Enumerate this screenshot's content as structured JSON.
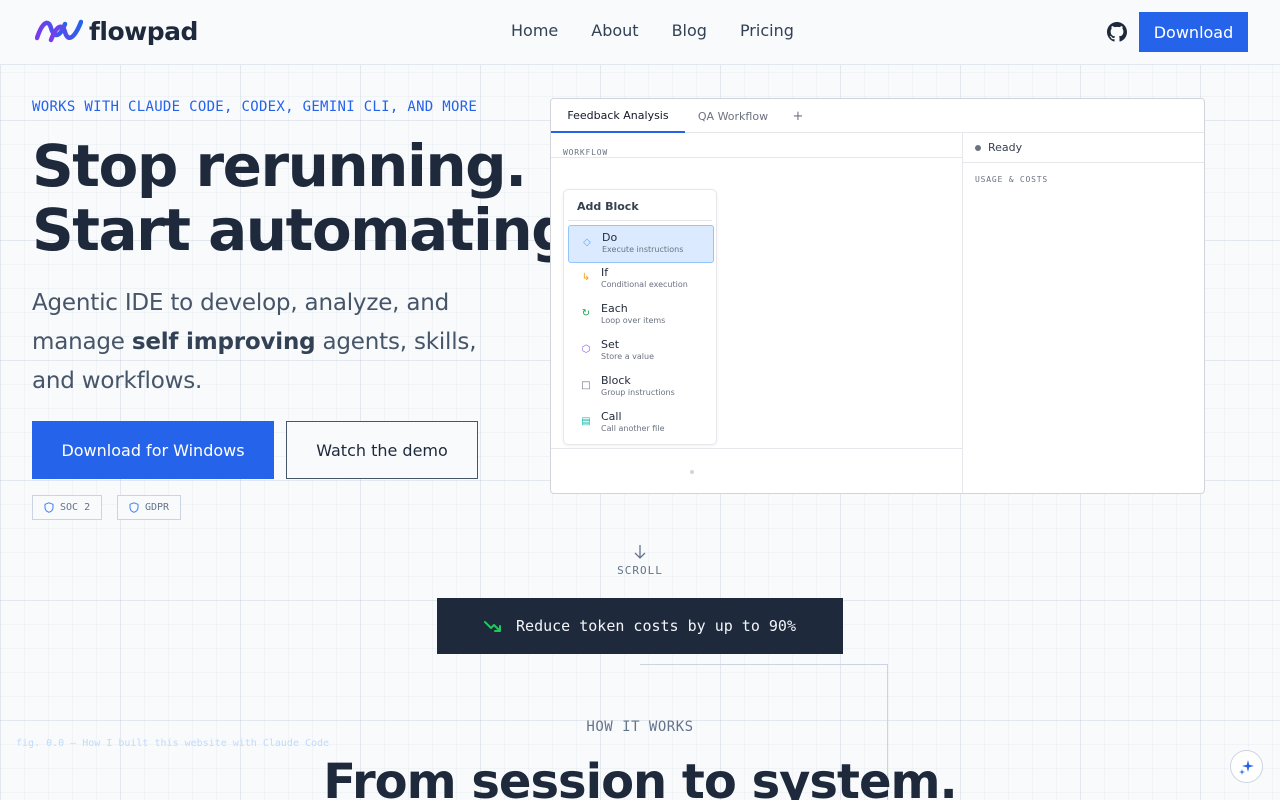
{
  "brand": {
    "name": "flowpad",
    "accent": "#2563eb",
    "dark": "#1e293b"
  },
  "nav": {
    "links": [
      "Home",
      "About",
      "Blog",
      "Pricing"
    ],
    "github_icon": "github-icon",
    "download_label": "Download"
  },
  "hero": {
    "eyebrow": "WORKS WITH CLAUDE CODE, CODEX, GEMINI CLI, AND MORE",
    "headline_line1": "Stop rerunning.",
    "headline_line2": "Start automating.",
    "sub_part1": "Agentic IDE to develop, analyze, and manage ",
    "sub_bold": "self improving",
    "sub_part2": " agents, skills, and workflows.",
    "cta_primary": "Download for Windows",
    "cta_secondary": "Watch the demo",
    "badges": [
      "SOC 2",
      "GDPR"
    ]
  },
  "app": {
    "tabs": [
      "Feedback Analysis",
      "QA Workflow",
      "+"
    ],
    "workflow_label": "WORKFLOW",
    "add_block_title": "Add Block",
    "menu": [
      {
        "title": "Do",
        "sub": "Execute instructions",
        "icon": "diamond-icon"
      },
      {
        "title": "If",
        "sub": "Conditional execution",
        "icon": "branch-icon"
      },
      {
        "title": "Each",
        "sub": "Loop over items",
        "icon": "loop-icon"
      },
      {
        "title": "Set",
        "sub": "Store a value",
        "icon": "hexagon-icon"
      },
      {
        "title": "Block",
        "sub": "Group instructions",
        "icon": "square-icon"
      },
      {
        "title": "Call",
        "sub": "Call another file",
        "icon": "call-icon"
      }
    ],
    "status": "Ready",
    "usage_label": "USAGE & COSTS"
  },
  "scroll_label": "SCROLL",
  "promo": "Reduce token costs by up to 90%",
  "fig_caption": "fig. 0.0 — How I built this website with Claude Code",
  "how": {
    "eyebrow": "HOW IT WORKS",
    "title": "From session to system."
  }
}
